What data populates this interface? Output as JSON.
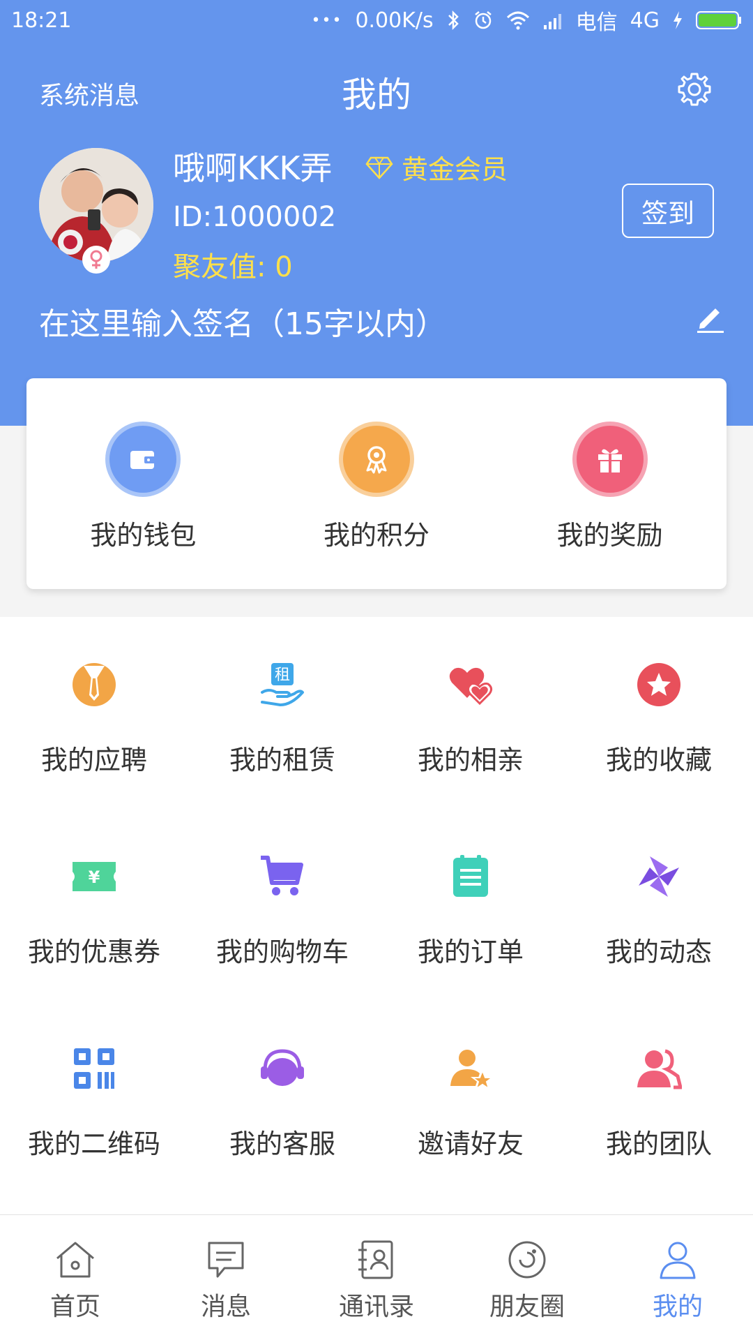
{
  "status_bar": {
    "time": "18:21",
    "dots": "•••",
    "speed": "0.00K/s",
    "carrier": "电信",
    "network": "4G"
  },
  "header": {
    "system_messages": "系统消息",
    "title": "我的"
  },
  "profile": {
    "username": "哦啊KKK弄",
    "vip_label": "黄金会员",
    "id_text": "ID:1000002",
    "points_text": "聚友值: 0",
    "checkin_label": "签到",
    "signature_placeholder": "在这里输入签名（15字以内）"
  },
  "wallet_card": {
    "items": [
      {
        "label": "我的钱包",
        "icon": "wallet-icon",
        "color": "#6f9cf3"
      },
      {
        "label": "我的积分",
        "icon": "medal-icon",
        "color": "#f5a84c"
      },
      {
        "label": "我的奖励",
        "icon": "gift-icon",
        "color": "#f0607a"
      }
    ]
  },
  "grid": {
    "items": [
      {
        "label": "我的应聘",
        "icon": "job-tie-icon"
      },
      {
        "label": "我的租赁",
        "icon": "rent-icon"
      },
      {
        "label": "我的相亲",
        "icon": "hearts-icon"
      },
      {
        "label": "我的收藏",
        "icon": "star-icon"
      },
      {
        "label": "我的优惠券",
        "icon": "coupon-icon"
      },
      {
        "label": "我的购物车",
        "icon": "cart-icon"
      },
      {
        "label": "我的订单",
        "icon": "order-icon"
      },
      {
        "label": "我的动态",
        "icon": "pinwheel-icon"
      },
      {
        "label": "我的二维码",
        "icon": "qrcode-icon"
      },
      {
        "label": "我的客服",
        "icon": "headset-icon"
      },
      {
        "label": "邀请好友",
        "icon": "invite-friend-icon"
      },
      {
        "label": "我的团队",
        "icon": "team-icon"
      }
    ],
    "rent_glyph": "租",
    "coupon_glyph": "¥"
  },
  "tab_bar": {
    "tabs": [
      {
        "label": "首页",
        "icon": "home-icon"
      },
      {
        "label": "消息",
        "icon": "message-icon"
      },
      {
        "label": "通讯录",
        "icon": "contacts-icon"
      },
      {
        "label": "朋友圈",
        "icon": "moments-icon"
      },
      {
        "label": "我的",
        "icon": "profile-icon"
      }
    ],
    "active_index": 4
  },
  "colors": {
    "header": "#6495ed",
    "vip": "#ffe04a",
    "active_tab": "#5b8ef0"
  }
}
